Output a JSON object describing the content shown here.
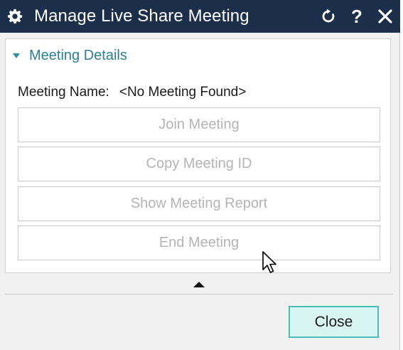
{
  "window": {
    "title": "Manage Live Share Meeting",
    "icons": {
      "settings": "gear-icon",
      "refresh": "refresh-icon",
      "help": "help-icon",
      "close": "close-icon"
    },
    "help_glyph": "?"
  },
  "section": {
    "title": "Meeting Details",
    "expanded": true
  },
  "meeting": {
    "name_label": "Meeting Name:",
    "name_value": "<No Meeting Found>"
  },
  "actions": [
    {
      "label": "Join Meeting",
      "enabled": false
    },
    {
      "label": "Copy Meeting ID",
      "enabled": false
    },
    {
      "label": "Show Meeting Report",
      "enabled": false
    },
    {
      "label": "End Meeting",
      "enabled": false
    }
  ],
  "footer": {
    "close_label": "Close"
  },
  "colors": {
    "titlebar": "#1c2f4a",
    "section_title": "#2b7f94",
    "disabled_text": "#b4b4b4",
    "close_bg": "#d9f5f3",
    "close_border": "#4cbcb4"
  }
}
